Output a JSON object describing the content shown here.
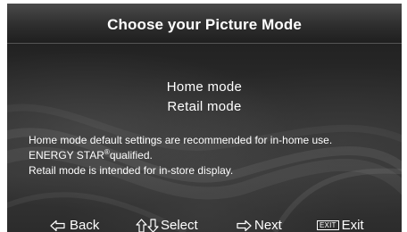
{
  "header": {
    "title": "Choose your Picture Mode"
  },
  "modes": [
    {
      "label": "Home mode"
    },
    {
      "label": "Retail mode"
    }
  ],
  "description": {
    "line1": "Home mode default settings are recommended for in-home use.",
    "line2_main": "ENERGY STAR",
    "line2_reg": "®",
    "line2_rest": "qualified.",
    "line3": "Retail mode is intended for in-store display."
  },
  "footer": {
    "back_label": "Back",
    "select_label": "Select",
    "next_label": "Next",
    "exit_key_label": "EXIT",
    "exit_label": "Exit"
  },
  "icons": {
    "back": "arrow-left-outline-icon",
    "select": "arrow-up-down-outline-icon",
    "next": "arrow-right-outline-icon",
    "exit": "exit-key-icon"
  }
}
